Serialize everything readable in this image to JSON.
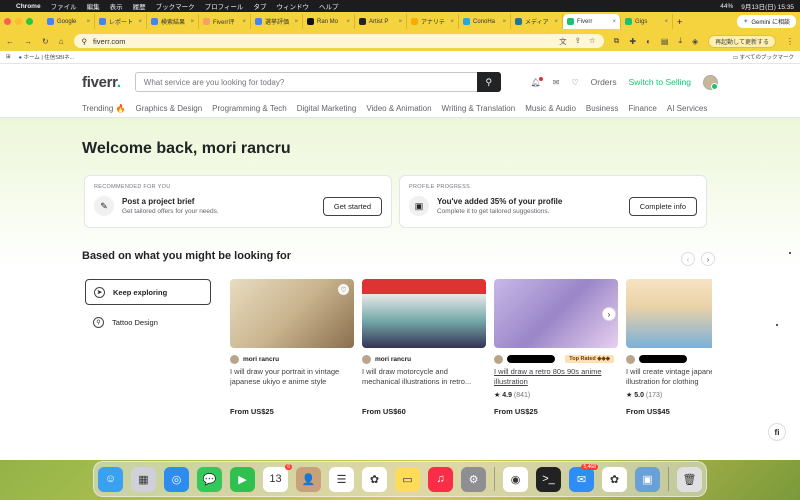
{
  "menubar": {
    "app": "Chrome",
    "items": [
      "ファイル",
      "編集",
      "表示",
      "履歴",
      "ブックマーク",
      "プロフィール",
      "タブ",
      "ウィンドウ",
      "ヘルプ"
    ],
    "battery": "44%",
    "clock": "9月13日(日) 15:35"
  },
  "tabs": [
    {
      "label": "Google",
      "color": "#4285f4"
    },
    {
      "label": "レポート",
      "color": "#4285f4"
    },
    {
      "label": "検索結果",
      "color": "#4285f4"
    },
    {
      "label": "Fiverr评",
      "color": "#f4a460"
    },
    {
      "label": "選挙評価",
      "color": "#4285f4"
    },
    {
      "label": "Ran Mo",
      "color": "#111111"
    },
    {
      "label": "Artist P",
      "color": "#222222"
    },
    {
      "label": "アナリテ",
      "color": "#f9ab00"
    },
    {
      "label": "ConoHa",
      "color": "#22aadd"
    },
    {
      "label": "メディア",
      "color": "#21759b"
    },
    {
      "label": "Fiverr",
      "color": "#1dbf73"
    },
    {
      "label": "Gigs",
      "color": "#1dbf73"
    }
  ],
  "gemini": "Gemini に相談",
  "url": "fiverr.com",
  "relaunch": "再起動して更新する",
  "bookmarks": {
    "home": "ホーム | 住信SBIネ...",
    "all": "すべてのブックマーク"
  },
  "header": {
    "logo": "fiverr",
    "logo_dot": ".",
    "search_placeholder": "What service are you looking for today?",
    "orders": "Orders",
    "switch": "Switch to Selling"
  },
  "categories": [
    "Trending 🔥",
    "Graphics & Design",
    "Programming & Tech",
    "Digital Marketing",
    "Video & Animation",
    "Writing & Translation",
    "Music & Audio",
    "Business",
    "Finance",
    "AI Services"
  ],
  "welcome": "Welcome back, mori rancru",
  "cards": [
    {
      "kicker": "RECOMMENDED FOR YOU",
      "title": "Post a project brief",
      "sub": "Get tailored offers for your needs.",
      "button": "Get started",
      "icon": "brief-icon"
    },
    {
      "kicker": "PROFILE PROGRESS",
      "title": "You've added 35% of your profile",
      "sub": "Complete it to get tailored suggestions.",
      "button": "Complete info",
      "icon": "briefcase-icon"
    }
  ],
  "section_title": "Based on what you might be looking for",
  "side": [
    {
      "label": "Keep exploring",
      "selected": true
    },
    {
      "label": "Tattoo Design",
      "selected": false
    }
  ],
  "gigs": [
    {
      "seller": "mori rancru",
      "title": "I will draw your portrait in vintage japanese ukiyo e anime style",
      "rating": "",
      "count": "",
      "badge": "",
      "price": "From US$25",
      "bg": "linear-gradient(135deg,#e8dcc0,#c9b48e 50%,#8b6e4e)"
    },
    {
      "seller": "mori rancru",
      "title": "I will draw motorcycle and mechanical illustrations in retro...",
      "rating": "",
      "count": "",
      "badge": "",
      "price": "From US$60",
      "bg": "linear-gradient(180deg,#d33 0%,#d33 22%,#e8e8e8 22%,#7aa 60%,#335 100%)"
    },
    {
      "seller": "",
      "title": "I will draw a retro 80s 90s anime illustration",
      "rating": "4.9",
      "count": "(841)",
      "badge": "Top Rated ◆◆◆",
      "price": "From US$25",
      "bg": "linear-gradient(135deg,#c8b8e8,#9a86c8 50%,#e8d0f0)"
    },
    {
      "seller": "",
      "title": "I will create vintage japanese illustration for clothing",
      "rating": "5.0",
      "count": "(173)",
      "badge": "",
      "price": "From US$45",
      "bg": "linear-gradient(180deg,#f6e3c3 0%,#ead2a8 40%,#7ab0d8 100%)"
    }
  ],
  "fab": "fi",
  "dock": [
    {
      "name": "finder",
      "color": "#3aa0f0",
      "glyph": "☺"
    },
    {
      "name": "launchpad",
      "color": "#d0d0d8",
      "glyph": "▦"
    },
    {
      "name": "safari",
      "color": "#2d8cf0",
      "glyph": "◎"
    },
    {
      "name": "messages",
      "color": "#34c759",
      "glyph": "💬"
    },
    {
      "name": "facetime",
      "color": "#30c050",
      "glyph": "▶"
    },
    {
      "name": "calendar",
      "color": "#ffffff",
      "glyph": "13",
      "badge": "6"
    },
    {
      "name": "contacts",
      "color": "#c8a07a",
      "glyph": "👤"
    },
    {
      "name": "reminders",
      "color": "#ffffff",
      "glyph": "☰"
    },
    {
      "name": "photos",
      "color": "#ffffff",
      "glyph": "✿"
    },
    {
      "name": "notes",
      "color": "#fedc5a",
      "glyph": "▭"
    },
    {
      "name": "music",
      "color": "#fa2d48",
      "glyph": "♫"
    },
    {
      "name": "settings",
      "color": "#8e8e93",
      "glyph": "⚙"
    },
    {
      "name": "chrome",
      "color": "#ffffff",
      "glyph": "◉"
    },
    {
      "name": "terminal",
      "color": "#222222",
      "glyph": ">_"
    },
    {
      "name": "mail",
      "color": "#2e8ef5",
      "glyph": "✉",
      "badge": "5,468"
    },
    {
      "name": "photos-2",
      "color": "#ffffff",
      "glyph": "✿"
    },
    {
      "name": "preview",
      "color": "#6aa0d8",
      "glyph": "▣"
    },
    {
      "name": "trash",
      "color": "#e0e0e0",
      "glyph": "🗑"
    }
  ]
}
